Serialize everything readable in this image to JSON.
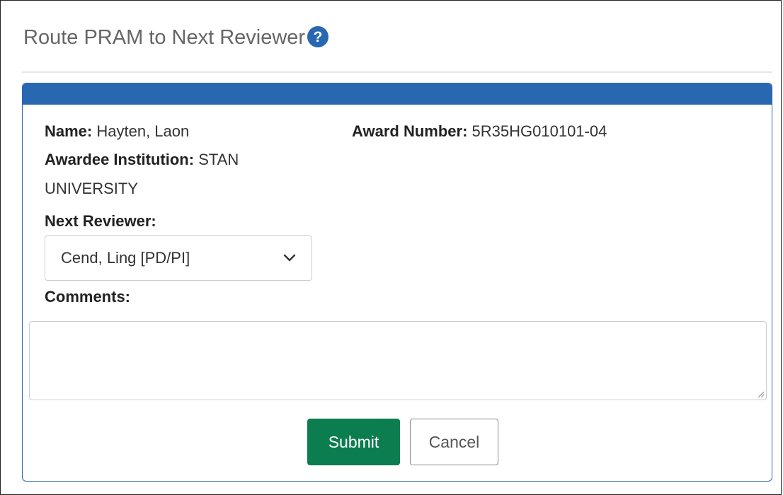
{
  "modal": {
    "title": "Route PRAM to Next Reviewer"
  },
  "details": {
    "name_label": "Name:",
    "name_value": "Hayten, Laon",
    "award_label": "Award Number:",
    "award_value": "5R35HG010101-04",
    "institution_label": "Awardee Institution:",
    "institution_value_line1": "STAN",
    "institution_value_line2": "UNIVERSITY"
  },
  "form": {
    "next_reviewer_label": "Next Reviewer:",
    "next_reviewer_selected": "Cend, Ling [PD/PI]",
    "comments_label": "Comments:",
    "comments_value": ""
  },
  "actions": {
    "submit_label": "Submit",
    "cancel_label": "Cancel"
  },
  "icons": {
    "help": "question-circle-icon",
    "select": "chevron-down-icon",
    "resize": "resize-grip-icon"
  },
  "colors": {
    "panel_accent": "#2a67b1",
    "submit_bg": "#0b7d4e",
    "title_text": "#666666"
  }
}
